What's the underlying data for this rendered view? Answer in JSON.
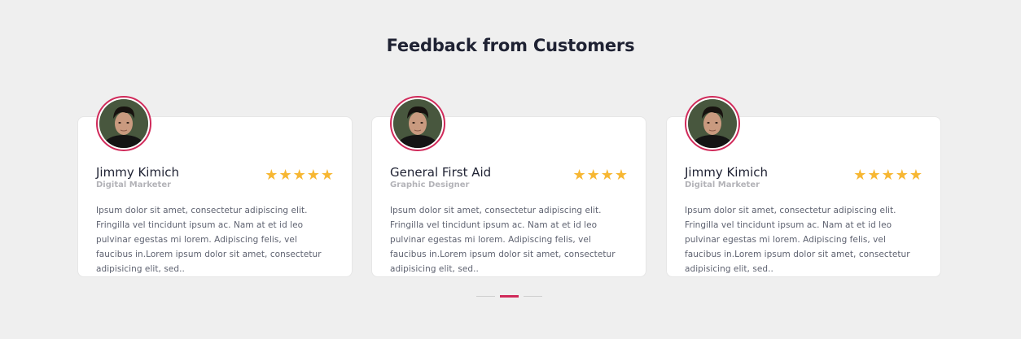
{
  "section": {
    "title": "Feedback from Customers"
  },
  "testimonials": [
    {
      "name": "Jimmy Kimich",
      "role": "Digital Marketer",
      "rating": 5,
      "text": "Ipsum dolor sit amet, consectetur adipiscing elit. Fringilla vel tincidunt ipsum ac. Nam at et id leo pulvinar egestas mi lorem. Adipiscing felis, vel faucibus in.Lorem ipsum dolor sit amet, consectetur adipisicing elit, sed.."
    },
    {
      "name": "General First Aid",
      "role": "Graphic Designer",
      "rating": 4,
      "text": "Ipsum dolor sit amet, consectetur adipiscing elit. Fringilla vel tincidunt ipsum ac. Nam at et id leo pulvinar egestas mi lorem. Adipiscing felis, vel faucibus in.Lorem ipsum dolor sit amet, consectetur adipisicing elit, sed.."
    },
    {
      "name": "Jimmy Kimich",
      "role": "Digital Marketer",
      "rating": 5,
      "text": "Ipsum dolor sit amet, consectetur adipiscing elit. Fringilla vel tincidunt ipsum ac. Nam at et id leo pulvinar egestas mi lorem. Adipiscing felis, vel faucibus in.Lorem ipsum dolor sit amet, consectetur adipisicing elit, sed.."
    }
  ],
  "pagination": {
    "count": 3,
    "active_index": 1
  },
  "colors": {
    "accent": "#d02a5a",
    "star": "#f7b733",
    "background": "#efefef"
  },
  "icons": {
    "star": "star-icon",
    "avatar": "avatar"
  }
}
